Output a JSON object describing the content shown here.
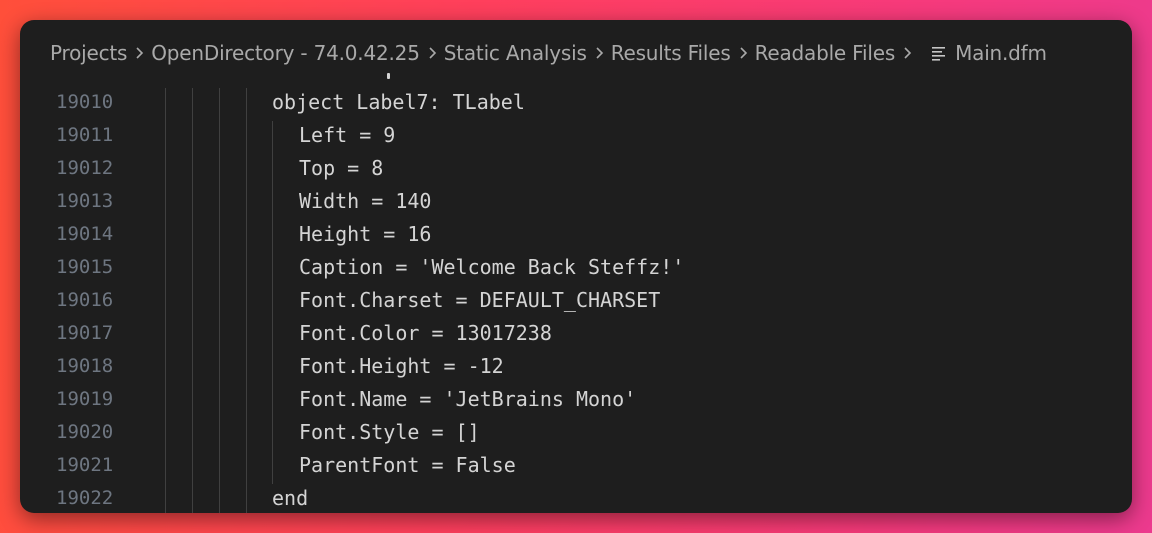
{
  "breadcrumb": {
    "items": [
      "Projects",
      "OpenDirectory - 74.0.42.25",
      "Static Analysis",
      "Results Files",
      "Readable Files"
    ],
    "file": "Main.dfm"
  },
  "code": {
    "lines": [
      {
        "num": "19010",
        "indent": 0,
        "text": "object Label7: TLabel"
      },
      {
        "num": "19011",
        "indent": 1,
        "text": "Left = 9"
      },
      {
        "num": "19012",
        "indent": 1,
        "text": "Top = 8"
      },
      {
        "num": "19013",
        "indent": 1,
        "text": "Width = 140"
      },
      {
        "num": "19014",
        "indent": 1,
        "text": "Height = 16"
      },
      {
        "num": "19015",
        "indent": 1,
        "text": "Caption = 'Welcome Back Steffz!'"
      },
      {
        "num": "19016",
        "indent": 1,
        "text": "Font.Charset = DEFAULT_CHARSET"
      },
      {
        "num": "19017",
        "indent": 1,
        "text": "Font.Color = 13017238"
      },
      {
        "num": "19018",
        "indent": 1,
        "text": "Font.Height = -12"
      },
      {
        "num": "19019",
        "indent": 1,
        "text": "Font.Name = 'JetBrains Mono'"
      },
      {
        "num": "19020",
        "indent": 1,
        "text": "Font.Style = []"
      },
      {
        "num": "19021",
        "indent": 1,
        "text": "ParentFont = False"
      },
      {
        "num": "19022",
        "indent": 0,
        "text": "end"
      }
    ]
  },
  "colors": {
    "editor_background": "#1e1e1e",
    "text": "#d4d4d4",
    "line_number": "#6e7681",
    "breadcrumb_text": "#a9a9a9",
    "indent_guide": "#404040"
  }
}
